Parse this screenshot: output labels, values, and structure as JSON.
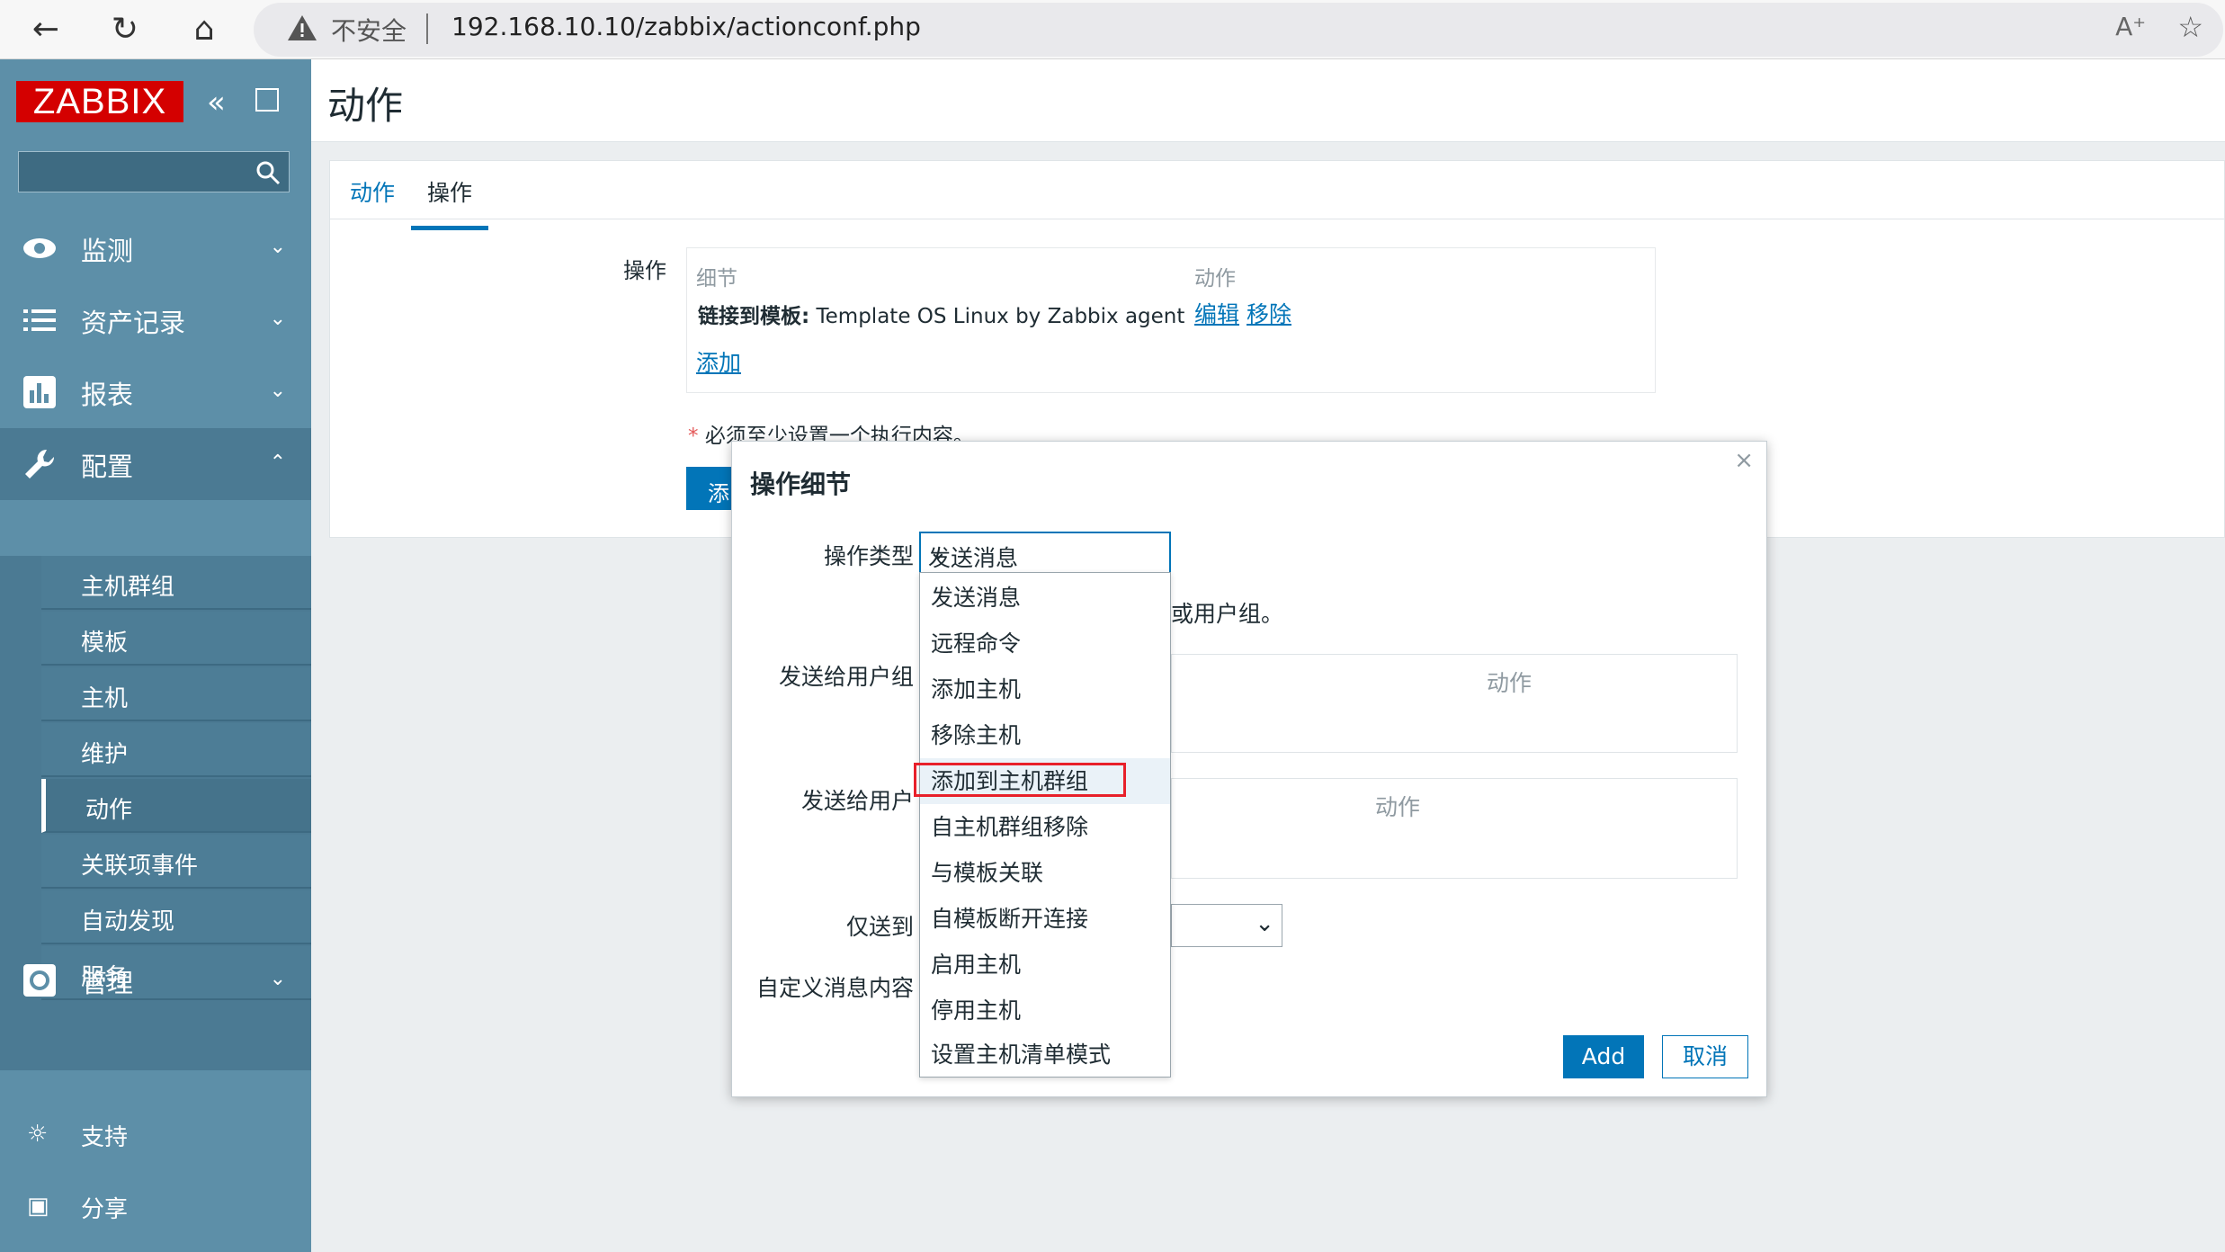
{
  "browser": {
    "insecure_label": "不安全",
    "url": "192.168.10.10/zabbix/actionconf.php",
    "read_aloud": "A̅"
  },
  "sidebar": {
    "logo": "ZABBIX",
    "menu": [
      {
        "label": "监测"
      },
      {
        "label": "资产记录"
      },
      {
        "label": "报表"
      },
      {
        "label": "配置"
      },
      {
        "label": "管理"
      }
    ],
    "config_items": [
      "主机群组",
      "模板",
      "主机",
      "维护",
      "动作",
      "关联项事件",
      "自动发现",
      "服务"
    ],
    "support": "支持",
    "share": "分享"
  },
  "page": {
    "title": "动作",
    "tabs": [
      "动作",
      "操作"
    ]
  },
  "operations": {
    "label": "操作",
    "col_details": "细节",
    "col_action": "动作",
    "row_bold": "链接到模板:",
    "row_text": " Template OS Linux by Zabbix agent",
    "edit": "编辑",
    "remove": "移除",
    "add": "添加",
    "note": "必须至少设置一个执行内容。",
    "required_mark": "*",
    "partial_button": "添"
  },
  "modal": {
    "title": "操作细节",
    "close": "×",
    "op_type_label": "操作类型",
    "op_type_value": "发送消息",
    "hint_suffix": "或用户组。",
    "send_group_label": "发送给用户组",
    "send_user_label": "发送给用户",
    "only_label": "仅送到",
    "custom_msg_label": "自定义消息内容",
    "table_action_header": "动作",
    "add_button": "Add",
    "cancel_button": "取消",
    "options": [
      "发送消息",
      "远程命令",
      "添加主机",
      "移除主机",
      "添加到主机群组",
      "自主机群组移除",
      "与模板关联",
      "自模板断开连接",
      "启用主机",
      "停用主机",
      "设置主机清单模式"
    ]
  }
}
